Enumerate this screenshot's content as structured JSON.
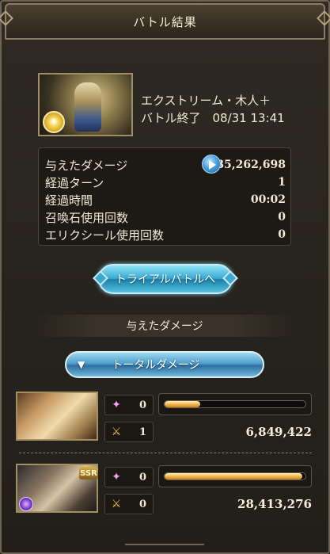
{
  "header": {
    "title": "バトル結果"
  },
  "battle": {
    "boss_name": "エクストリーム・木人＋",
    "end_line": "バトル終了　08/31 13:41"
  },
  "stats": [
    {
      "label": "与えたダメージ",
      "value": "35,262,698"
    },
    {
      "label": "経過ターン",
      "value": "1"
    },
    {
      "label": "経過時間",
      "value": "00:02"
    },
    {
      "label": "召喚石使用回数",
      "value": "0"
    },
    {
      "label": "エリクシール使用回数",
      "value": "0"
    }
  ],
  "trial_button": {
    "label": "トライアルバトルへ"
  },
  "section": {
    "title": "与えたダメージ"
  },
  "total_button": {
    "label": "トータルダメージ",
    "icon": "▼"
  },
  "members": [
    {
      "special_count": "0",
      "attack_count": "1",
      "damage": "6,849,422",
      "gauge_fill": 0.25
    },
    {
      "badge": "SSR",
      "special_count": "0",
      "attack_count": "0",
      "damage": "28,413,276",
      "gauge_fill": 0.98
    }
  ],
  "icons": {
    "special": "✦",
    "attack": "⚔",
    "boss_element": "✷"
  },
  "colors": {
    "accent_blue": "#3aaad0",
    "gauge_gold": "#f0b44a",
    "frame_brown": "#8d7c62"
  }
}
